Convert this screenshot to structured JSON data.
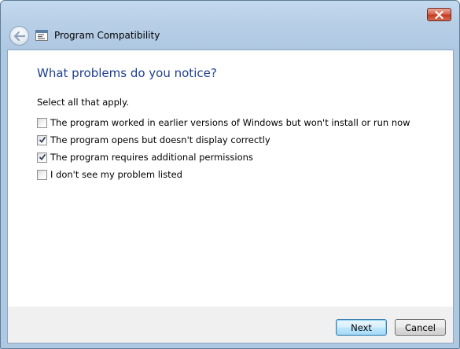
{
  "window": {
    "title": "Program Compatibility",
    "close_icon": "close-icon",
    "back_icon": "back-arrow-icon",
    "app_icon": "program-compatibility-icon"
  },
  "main": {
    "heading": "What problems do you notice?",
    "instruction": "Select all that apply.",
    "options": [
      {
        "label": "The program worked in earlier versions of Windows but won't install or run now",
        "checked": false
      },
      {
        "label": "The program opens but doesn't display correctly",
        "checked": true
      },
      {
        "label": "The program requires additional permissions",
        "checked": true
      },
      {
        "label": "I don't see my problem listed",
        "checked": false
      }
    ]
  },
  "footer": {
    "next_label": "Next",
    "cancel_label": "Cancel"
  },
  "colors": {
    "heading": "#1e3f91",
    "frame": "#b7cee6",
    "close_button": "#c23b22"
  }
}
